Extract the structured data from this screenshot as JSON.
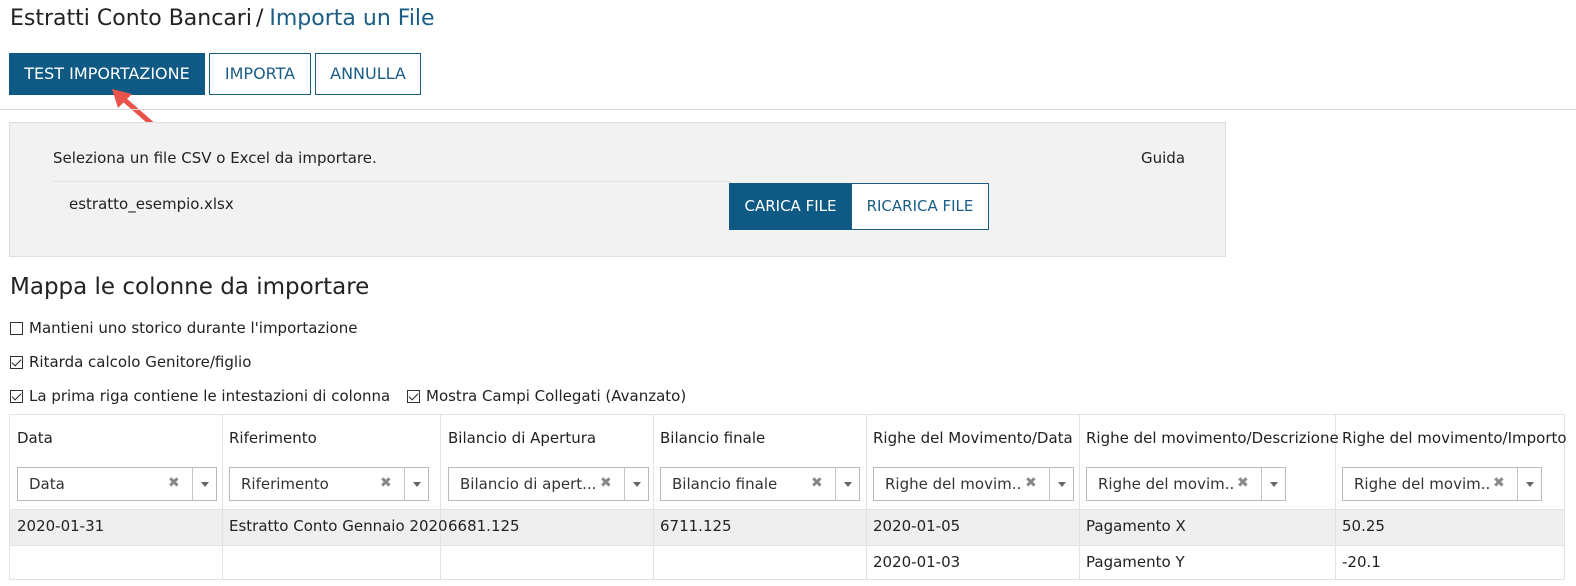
{
  "breadcrumb": {
    "parent": "Estratti Conto Bancari",
    "separator": "/",
    "current": "Importa un File"
  },
  "toolbar": {
    "test_label": "TEST IMPORTAZIONE",
    "import_label": "IMPORTA",
    "cancel_label": "ANNULLA"
  },
  "upload": {
    "prompt": "Seleziona un file CSV o Excel da importare.",
    "guide": "Guida",
    "file_name": "estratto_esempio.xlsx",
    "load_label": "CARICA FILE",
    "reload_label": "RICARICA FILE"
  },
  "mapping": {
    "title": "Mappa le colonne da importare",
    "options": [
      {
        "label": "Mantieni uno storico durante l'importazione",
        "checked": false
      },
      {
        "label": "Ritarda calcolo Genitore/figlio",
        "checked": true
      },
      {
        "label": "La prima riga contiene le intestazioni di colonna",
        "checked": true
      },
      {
        "label": "Mostra Campi Collegati (Avanzato)",
        "checked": true
      }
    ]
  },
  "table": {
    "headers": [
      "Data",
      "Riferimento",
      "Bilancio di Apertura",
      "Bilancio finale",
      "Righe del Movimento/Data",
      "Righe del movimento/Descrizione",
      "Righe del movimento/Importo"
    ],
    "selects": [
      "Data",
      "Riferimento",
      "Bilancio di apert...",
      "Bilancio finale",
      "Righe del movim...",
      "Righe del movim...",
      "Righe del movim..."
    ],
    "clear_symbol": "✖",
    "rows": [
      [
        "2020-01-31",
        "Estratto Conto Gennaio 2020",
        "6681.125",
        "6711.125",
        "2020-01-05",
        "Pagamento X",
        "50.25"
      ],
      [
        "",
        "",
        "",
        "",
        "2020-01-03",
        "Pagamento Y",
        "-20.1"
      ]
    ]
  },
  "colors": {
    "accent": "#0f5a84",
    "link": "#1a5d86",
    "panel": "#f2f2f2",
    "arrow": "#e8534a"
  }
}
